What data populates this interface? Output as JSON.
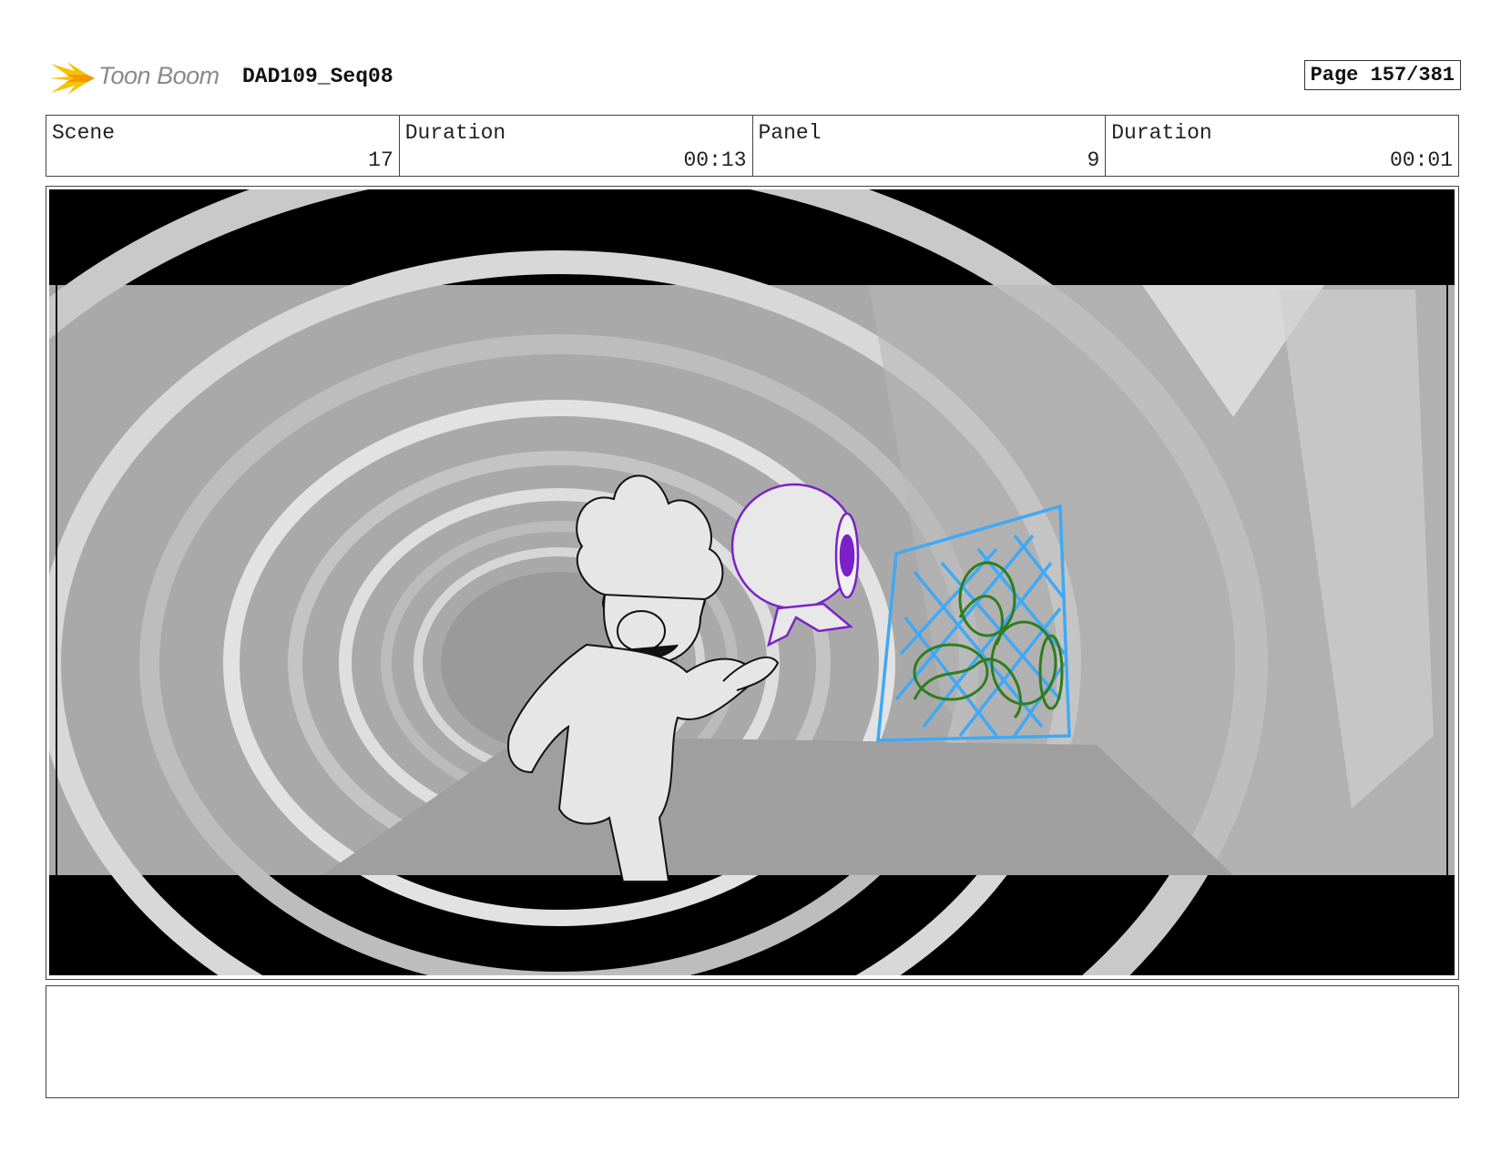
{
  "header": {
    "logo_text": "Toon Boom",
    "logo_icon": "toon-boom-burst-icon",
    "sequence_title": "DAD109_Seq08",
    "page_label": "Page 157/381"
  },
  "info": {
    "scene_label": "Scene",
    "scene_value": "17",
    "scene_duration_label": "Duration",
    "scene_duration_value": "00:13",
    "panel_label": "Panel",
    "panel_value": "9",
    "panel_duration_label": "Duration",
    "panel_duration_value": "00:01"
  },
  "panel_image": {
    "colors": {
      "letterbox": "#000000",
      "tunnel_gray": "#a8a8a8",
      "character_line": "#111111",
      "robot_purple": "#7a22c8",
      "grate_blue": "#3fa9f5",
      "plant_green": "#2f7d1e"
    }
  },
  "notes": {
    "text": ""
  }
}
